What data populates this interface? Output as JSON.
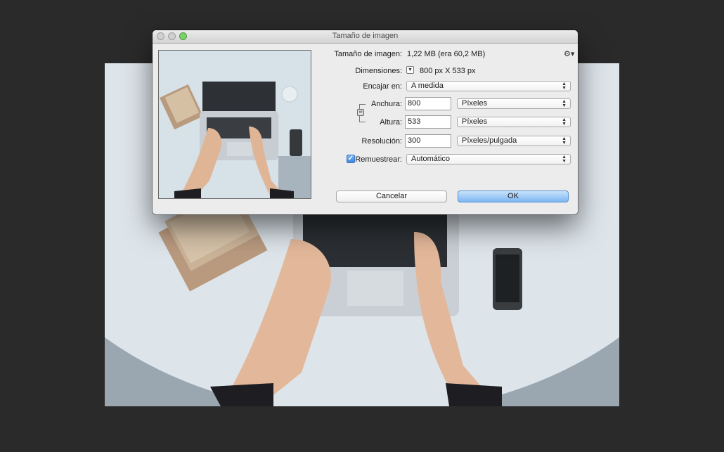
{
  "dialog": {
    "title": "Tamaño de imagen",
    "image_size_label": "Tamaño de imagen:",
    "image_size_value": "1,22 MB (era 60,2 MB)",
    "dimensions_label": "Dimensiones:",
    "dimensions_value": "800 px X 533 px",
    "fit_label": "Encajar en:",
    "fit_value": "A medida",
    "width_label": "Anchura:",
    "width_value": "800",
    "width_unit": "Píxeles",
    "height_label": "Altura:",
    "height_value": "533",
    "height_unit": "Píxeles",
    "resolution_label": "Resolución:",
    "resolution_value": "300",
    "resolution_unit": "Píxeles/pulgada",
    "resample_label": "Remuestrear:",
    "resample_checked": true,
    "resample_value": "Automático",
    "cancel_label": "Cancelar",
    "ok_label": "OK"
  },
  "icons": {
    "gear": "gear-icon",
    "chain": "link-icon",
    "dimensions_toggle": "triangle-down-icon",
    "select_arrows": "updown-chevron-icon",
    "checkbox": "checkmark-icon"
  },
  "colors": {
    "workspace": "#2a2a2a",
    "dialog": "#ececec",
    "ok_button": "#7db6f1",
    "zoom_button": "#7ed06a"
  }
}
